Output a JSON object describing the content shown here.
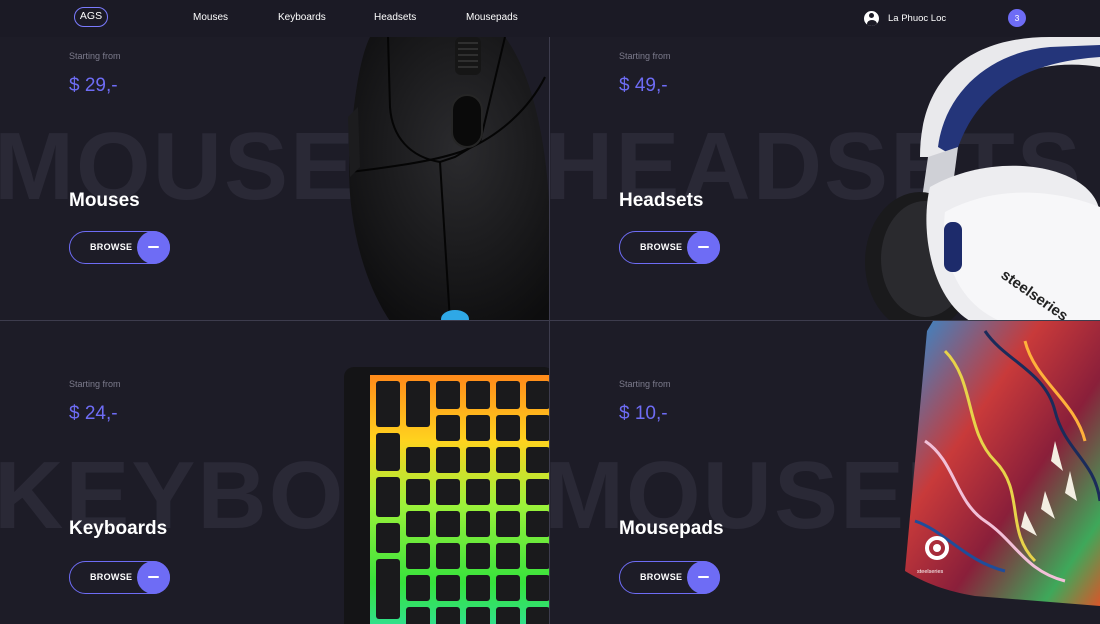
{
  "nav": {
    "logo": "AGS",
    "links": [
      "Mouses",
      "Keyboards",
      "Headsets",
      "Mousepads"
    ],
    "user_name": "La Phuoc Loc",
    "cart_count": "3"
  },
  "tiles": [
    {
      "bg_word": "MOUSES",
      "starting": "Starting from",
      "price": "$ 29,-",
      "title": "Mouses",
      "button": "BROWSE"
    },
    {
      "bg_word": "HEADSETS",
      "starting": "Starting from",
      "price": "$ 49,-",
      "title": "Headsets",
      "button": "BROWSE"
    },
    {
      "bg_word": "KEYBOARDS",
      "starting": "Starting from",
      "price": "$ 24,-",
      "title": "Keyboards",
      "button": "BROWSE"
    },
    {
      "bg_word": "MOUSEPADS",
      "starting": "Starting from",
      "price": "$ 10,-",
      "title": "Mousepads",
      "button": "BROWSE"
    }
  ],
  "brand": "steelseries",
  "colors": {
    "accent": "#6e6cf5",
    "background": "#1d1c27",
    "nav": "#1b1a25"
  }
}
